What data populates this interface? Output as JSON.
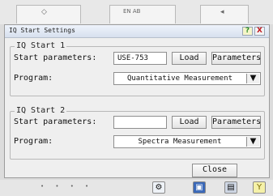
{
  "background": {
    "badge": "EN AB"
  },
  "dialog": {
    "title": "IQ Start Settings",
    "help_symbol": "?",
    "close_symbol": "X",
    "groups": [
      {
        "legend": "IQ Start 1",
        "start_params_label": "Start parameters:",
        "start_params_value": "USE-753",
        "load_label": "Load",
        "parameters_label": "Parameters",
        "program_label": "Program:",
        "program_value": "Quantitative Measurement"
      },
      {
        "legend": "IQ Start 2",
        "start_params_label": "Start parameters:",
        "start_params_value": "",
        "load_label": "Load",
        "parameters_label": "Parameters",
        "program_label": "Program:",
        "program_value": "Spectra Measurement"
      }
    ],
    "close_label": "Close"
  },
  "colors": {
    "dialog_bg": "#efefef",
    "title_gradient_top": "#eef3fb",
    "close_x": "#c0191f",
    "help_icon": "#2a8a2a"
  }
}
